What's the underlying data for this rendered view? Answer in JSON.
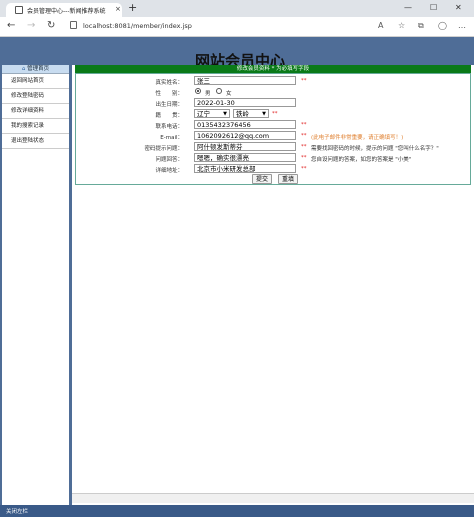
{
  "browser": {
    "tab_title": "会员管理中心---新闻推荐系统",
    "tab_close": "×",
    "new_tab": "+",
    "url": "localhost:8081/member/index.jsp",
    "window_controls": [
      "—",
      "☐",
      "✕"
    ]
  },
  "site": {
    "title": "网站会员中心"
  },
  "sidebar": {
    "header": "管理首页",
    "items": [
      {
        "label": "返回网站首页"
      },
      {
        "label": "修改登陆密码"
      },
      {
        "label": "修改详细资料"
      },
      {
        "label": "我的搜索记录"
      },
      {
        "label": "退出登陆状态"
      }
    ]
  },
  "form": {
    "header": "修改会员资料 * 为必填写字段",
    "name_label": "真实姓名：",
    "name_value": "张三",
    "gender_label": "性　　别：",
    "gender_options": [
      "男",
      "女"
    ],
    "gender_selected": "男",
    "birth_label": "出生日期：",
    "birth_value": "2022-01-30",
    "region_label": "籍　　贯：",
    "province_value": "辽宁",
    "city_value": "铁岭",
    "phone_label": "联系电话：",
    "phone_value": "0135432376456",
    "email_label": "E-mail：",
    "email_value": "1062092612@qq.com",
    "email_hint": "(此电子邮件非常重要，请正确填写！)",
    "question_label": "密码提示问题：",
    "question_value": "阿什顿发斯蒂芬",
    "question_hint": "需要找回密码的时候，提示的问题 \"您叫什么名字？\"",
    "answer_label": "问题回答：",
    "answer_value": "嗯嗯，确实很漂亮",
    "answer_hint": "您自设问题的答案，如您的答案是 \"小美\"",
    "address_label": "详细地址：",
    "address_value": "北京市小米研发总部",
    "required_mark": "**",
    "submit_label": "提交",
    "reset_label": "重填"
  },
  "status": {
    "text": "关闭左栏"
  }
}
